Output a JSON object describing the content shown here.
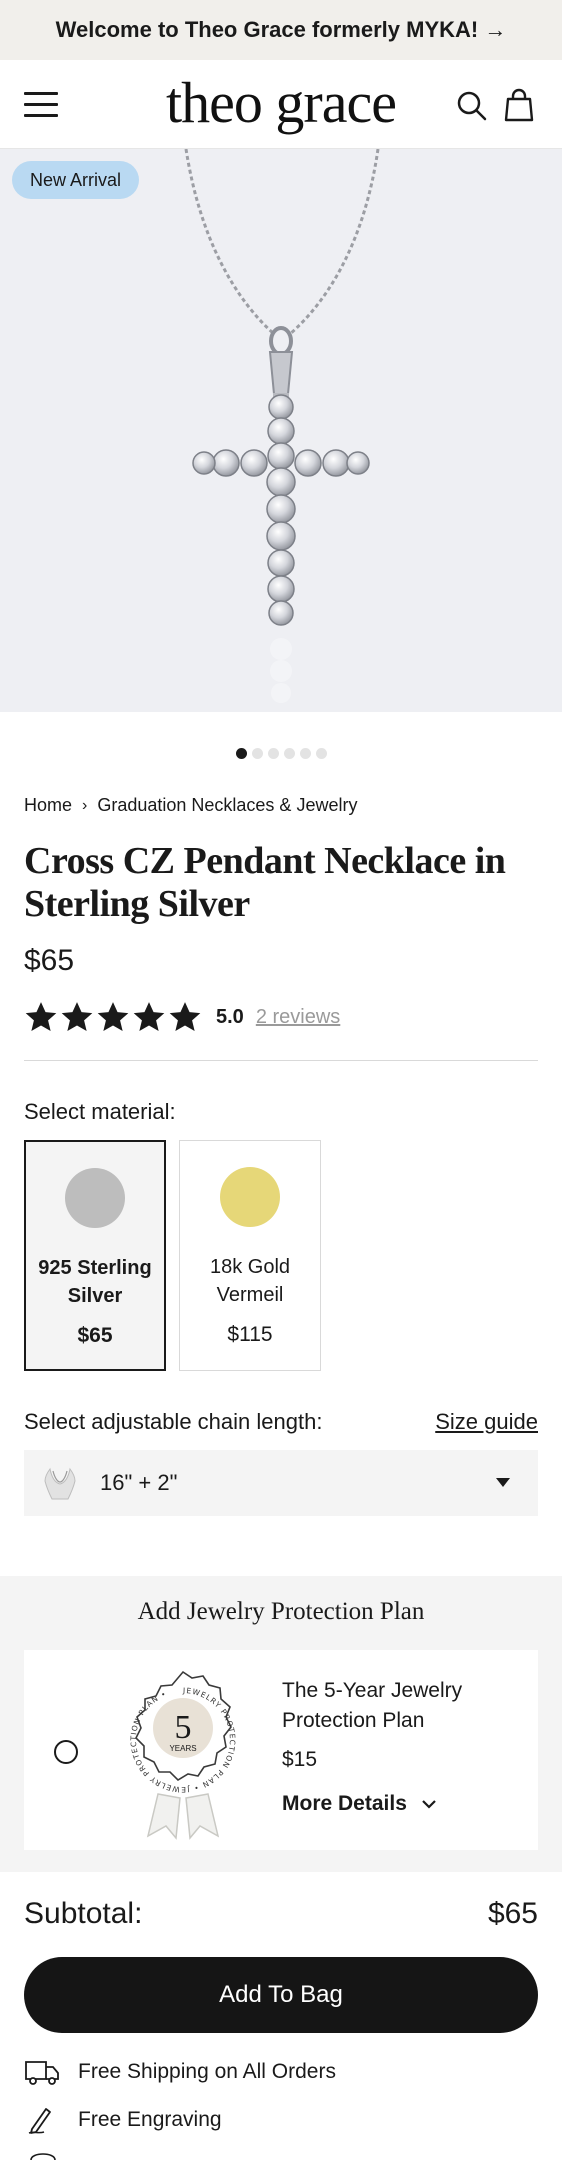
{
  "announcement": "Welcome to Theo Grace formerly MYKA! →",
  "header": {
    "logo": "theo grace"
  },
  "hero": {
    "badge": "New Arrival",
    "slide_count": 6,
    "active_slide": 1
  },
  "breadcrumb": {
    "home": "Home",
    "separator": "›",
    "category": "Graduation Necklaces & Jewelry"
  },
  "product": {
    "title": "Cross CZ Pendant Necklace in Sterling Silver",
    "price": "$65",
    "rating": 5.0,
    "rating_text": "5.0",
    "reviews": "2 reviews"
  },
  "material": {
    "label": "Select material:",
    "options": [
      {
        "name": "925 Sterling Silver",
        "price": "$65",
        "color": "#bdbdbd",
        "selected": true
      },
      {
        "name": "18k Gold Vermeil",
        "price": "$115",
        "color": "#e6d778",
        "selected": false
      }
    ]
  },
  "chain": {
    "label": "Select adjustable chain length:",
    "size_guide": "Size guide",
    "value": "16\" + 2\""
  },
  "protection": {
    "title": "Add Jewelry Protection Plan",
    "seal_number": "5",
    "seal_unit": "YEARS",
    "seal_ring": "JEWELRY PROTECTION PLAN • JEWELRY PROTECTION PLAN •",
    "plan_name": "The 5-Year Jewelry Protection Plan",
    "plan_price": "$15",
    "details": "More Details"
  },
  "subtotal": {
    "label": "Subtotal:",
    "value": "$65"
  },
  "cta": "Add To Bag",
  "perks": [
    "Free Shipping on All Orders",
    "Free Engraving"
  ],
  "colors": {
    "announce_bg": "#f1efeb",
    "badge_bg": "#b9d9f2",
    "button_bg": "#151515",
    "panel_bg": "#f4f4f4"
  }
}
